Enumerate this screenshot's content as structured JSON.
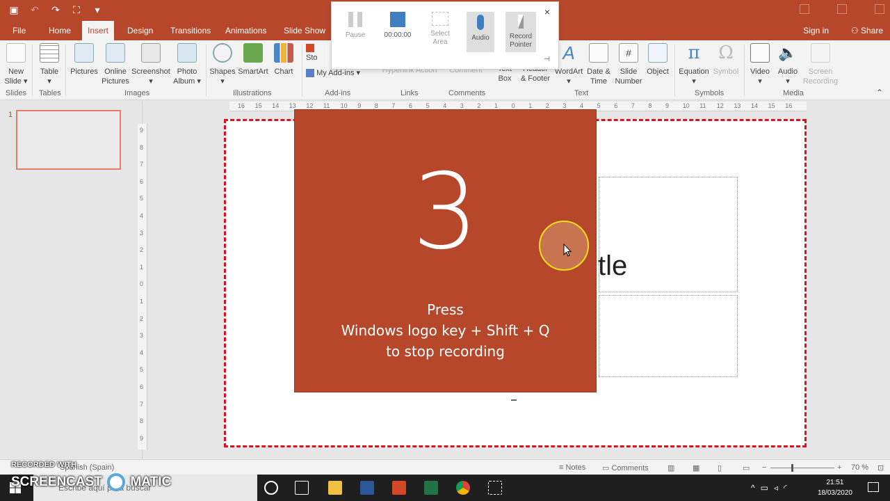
{
  "tabs": [
    "File",
    "Home",
    "Insert",
    "Design",
    "Transitions",
    "Animations",
    "Slide Show"
  ],
  "active_tab": "Insert",
  "account": {
    "signin": "Sign in",
    "share": "Share"
  },
  "ribbon": {
    "new_slide": "New\nSlide ▾",
    "table": "Table\n▾",
    "pictures": "Pictures",
    "online_pictures": "Online\nPictures",
    "screenshot": "Screenshot\n▾",
    "photo_album": "Photo\nAlbum ▾",
    "shapes": "Shapes\n▾",
    "smartart": "SmartArt",
    "chart": "Chart",
    "store": "Sto",
    "my_addins": "My Add-ins",
    "hyperlink": "Hyperlink  Action",
    "comment": "Comment",
    "text_box": "Text\nBox",
    "header_footer": "Header\n& Footer",
    "wordart": "WordArt\n▾",
    "date_time": "Date &\nTime",
    "slide_number": "Slide\nNumber",
    "object": "Object",
    "equation": "Equation\n▾",
    "symbol": "Symbol",
    "video": "Video\n▾",
    "audio": "Audio\n▾",
    "screen_recording": "Screen\nRecording"
  },
  "groups": [
    "Slides",
    "Tables",
    "Images",
    "Illustrations",
    "Add-ins",
    "Links",
    "Comments",
    "Text",
    "Symbols",
    "Media"
  ],
  "recorder": {
    "pause": "Pause",
    "timer": "00:00:00",
    "select_area": "Select\nArea",
    "audio": "Audio",
    "record_pointer": "Record\nPointer",
    "close": "×"
  },
  "thumbnail_number": "1",
  "slide_title_fragment": "tle",
  "countdown": {
    "number": "3",
    "message_line1": "Press",
    "message_line2": "Windows logo key + Shift + Q",
    "message_line3": "to stop recording"
  },
  "hruler_labels": [
    "16",
    "15",
    "14",
    "13",
    "12",
    "11",
    "10",
    "9",
    "8",
    "7",
    "6",
    "5",
    "4",
    "3",
    "2",
    "1",
    "0",
    "1",
    "2",
    "3",
    "4",
    "5",
    "6",
    "7",
    "8",
    "9",
    "10",
    "11",
    "12",
    "13",
    "14",
    "15",
    "16"
  ],
  "vruler_labels": [
    "9",
    "8",
    "7",
    "6",
    "5",
    "4",
    "3",
    "2",
    "1",
    "0",
    "1",
    "2",
    "3",
    "4",
    "5",
    "6",
    "7",
    "8",
    "9"
  ],
  "status": {
    "language": "Spanish (Spain)",
    "notes": "Notes",
    "comments": "Comments",
    "zoom": "70 %"
  },
  "taskbar": {
    "search_placeholder": "Escribe aquí para buscar",
    "time": "21:51",
    "date": "18/03/2020"
  },
  "watermark": {
    "line1": "RECORDED WITH",
    "line2": "SCREENCAST",
    "line3": "MATIC"
  },
  "colors": {
    "accent": "#b7472a",
    "slide_border": "#e0101c",
    "cursor_ring": "#f2e019"
  }
}
